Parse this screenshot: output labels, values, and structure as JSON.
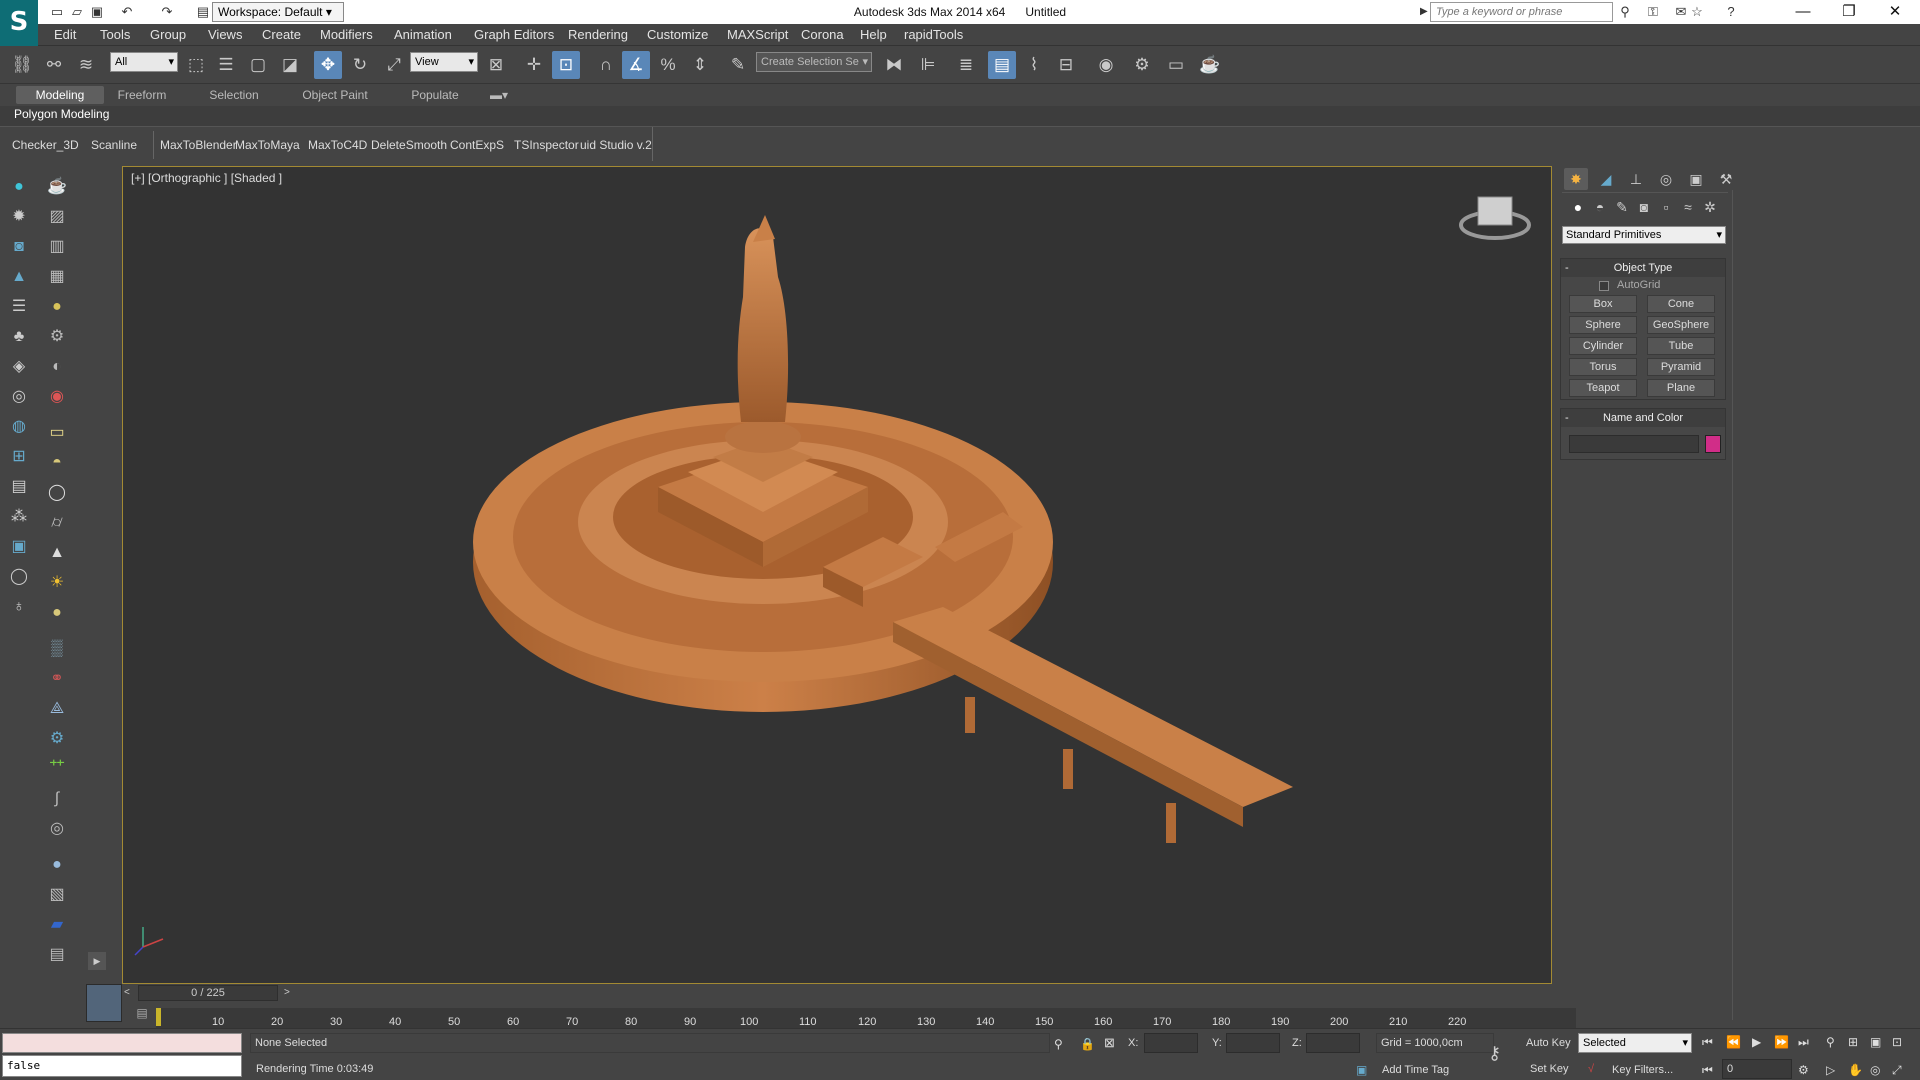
{
  "titlebar": {
    "app_title": "Autodesk 3ds Max  2014 x64",
    "doc_title": "Untitled",
    "workspace": "Workspace: Default",
    "search_placeholder": "Type a keyword or phrase"
  },
  "menu": [
    "Edit",
    "Tools",
    "Group",
    "Views",
    "Create",
    "Modifiers",
    "Animation",
    "Graph Editors",
    "Rendering",
    "Customize",
    "MAXScript",
    "Corona",
    "Help",
    "rapidTools"
  ],
  "toolbar": {
    "selection_filter": "All",
    "ref_coord": "View",
    "named_selection": "Create Selection Se"
  },
  "ribbon": {
    "tabs": [
      "Modeling",
      "Freeform",
      "Selection",
      "Object Paint",
      "Populate"
    ],
    "panel_label": "Polygon Modeling"
  },
  "scripts": [
    "Checker_3D",
    "Scanline",
    "MaxToBlender",
    "MaxToMaya",
    "MaxToC4D",
    "DeleteSmooth",
    "ContExpS",
    "TSInspector",
    "uid Studio v.2"
  ],
  "viewport": {
    "label": "[+] [Orthographic ] [Shaded ]",
    "model_color": "#c47a44"
  },
  "command_panel": {
    "category": "Standard Primitives",
    "object_type_header": "Object Type",
    "autogrid_label": "AutoGrid",
    "primitives": [
      "Box",
      "Cone",
      "Sphere",
      "GeoSphere",
      "Cylinder",
      "Tube",
      "Torus",
      "Pyramid",
      "Teapot",
      "Plane"
    ],
    "name_color_header": "Name and Color",
    "object_color": "#d12d88"
  },
  "timeline": {
    "frame_display": "0 / 225",
    "ticks": [
      "10",
      "20",
      "30",
      "40",
      "50",
      "60",
      "70",
      "80",
      "90",
      "100",
      "110",
      "120",
      "130",
      "140",
      "150",
      "160",
      "170",
      "180",
      "190",
      "200",
      "210",
      "220"
    ]
  },
  "status": {
    "maxscript_output": "false",
    "selection": "None Selected",
    "render_time": "Rendering Time  0:03:49",
    "x_label": "X:",
    "y_label": "Y:",
    "z_label": "Z:",
    "grid": "Grid = 1000,0cm",
    "add_time_tag": "Add Time Tag",
    "auto_key": "Auto Key",
    "set_key": "Set Key",
    "key_mode": "Selected",
    "key_filters": "Key Filters...",
    "frame": "0"
  }
}
